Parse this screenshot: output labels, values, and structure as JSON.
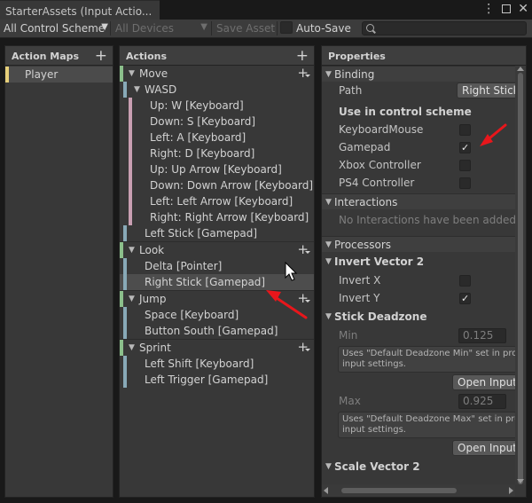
{
  "window": {
    "tab_title": "StarterAssets (Input Actio..."
  },
  "toolbar": {
    "scheme_value": "All Control Scheme",
    "devices_value": "All Devices",
    "save_label": "Save Asset",
    "autosave_label": "Auto-Save",
    "autosave_checked": false
  },
  "action_maps": {
    "header": "Action Maps",
    "items": [
      {
        "label": "Player"
      }
    ]
  },
  "actions": {
    "header": "Actions",
    "rows": [
      {
        "label": "Move",
        "kind": "action"
      },
      {
        "label": "WASD",
        "kind": "composite"
      },
      {
        "label": "Up: W [Keyboard]",
        "kind": "part"
      },
      {
        "label": "Down: S [Keyboard]",
        "kind": "part"
      },
      {
        "label": "Left: A [Keyboard]",
        "kind": "part"
      },
      {
        "label": "Right: D [Keyboard]",
        "kind": "part"
      },
      {
        "label": "Up: Up Arrow [Keyboard]",
        "kind": "part"
      },
      {
        "label": "Down: Down Arrow [Keyboard]",
        "kind": "part"
      },
      {
        "label": "Left: Left Arrow [Keyboard]",
        "kind": "part"
      },
      {
        "label": "Right: Right Arrow [Keyboard]",
        "kind": "part"
      },
      {
        "label": "Left Stick [Gamepad]",
        "kind": "binding"
      },
      {
        "label": "Look",
        "kind": "action"
      },
      {
        "label": "Delta [Pointer]",
        "kind": "binding"
      },
      {
        "label": "Right Stick [Gamepad]",
        "kind": "binding",
        "selected": true
      },
      {
        "label": "Jump",
        "kind": "action"
      },
      {
        "label": "Space [Keyboard]",
        "kind": "binding"
      },
      {
        "label": "Button South [Gamepad]",
        "kind": "binding"
      },
      {
        "label": "Sprint",
        "kind": "action"
      },
      {
        "label": "Left Shift [Keyboard]",
        "kind": "binding"
      },
      {
        "label": "Left Trigger [Gamepad]",
        "kind": "binding"
      }
    ]
  },
  "properties": {
    "header": "Properties",
    "binding": {
      "title": "Binding",
      "path_label": "Path",
      "path_value": "Right Stick [Gamepad]",
      "scheme_title": "Use in control scheme",
      "schemes": [
        {
          "label": "KeyboardMouse",
          "checked": false
        },
        {
          "label": "Gamepad",
          "checked": true
        },
        {
          "label": "Xbox Controller",
          "checked": false
        },
        {
          "label": "PS4 Controller",
          "checked": false
        }
      ]
    },
    "interactions": {
      "title": "Interactions",
      "empty_note": "No Interactions have been added."
    },
    "processors": {
      "title": "Processors",
      "invert": {
        "title": "Invert Vector 2",
        "x_label": "Invert X",
        "x_checked": false,
        "y_label": "Invert Y",
        "y_checked": true
      },
      "deadzone": {
        "title": "Stick Deadzone",
        "min_label": "Min",
        "min_value": "0.125",
        "min_help_1": "Uses \"Default Deadzone Min\" set in project",
        "min_help_2": "input settings.",
        "open_input_label": "Open Input",
        "max_label": "Max",
        "max_value": "0.925",
        "max_help_1": "Uses \"Default Deadzone Max\" set in project",
        "max_help_2": "input settings."
      },
      "next_title": "Scale Vector 2"
    }
  },
  "colors": {
    "action_bar": "#8bbf8b",
    "binding_bar": "#88a9b7",
    "part_bar": "#c99fb2",
    "map_bar": "#e6cf7a",
    "annotation_arrow": "#e8161b"
  }
}
